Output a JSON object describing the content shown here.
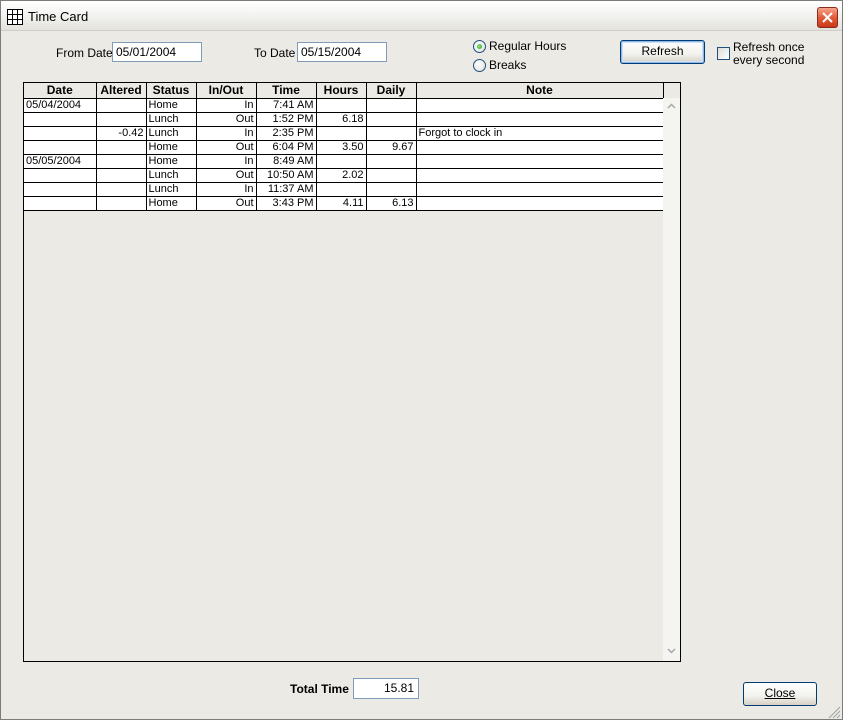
{
  "window": {
    "title": "Time Card",
    "icon": "grid-icon",
    "close_icon": "close-icon"
  },
  "filters": {
    "from_date_label": "From Date",
    "from_date_value": "05/01/2004",
    "to_date_label": "To Date",
    "to_date_value": "05/15/2004",
    "radio_regular": "Regular Hours",
    "radio_breaks": "Breaks",
    "selected_mode": "Regular Hours",
    "refresh_button": "Refresh",
    "refresh_checkbox_line1": "Refresh once",
    "refresh_checkbox_line2": "every second",
    "refresh_checkbox_checked": false
  },
  "grid": {
    "columns": [
      "Date",
      "Altered",
      "Status",
      "In/Out",
      "Time",
      "Hours",
      "Daily",
      "Note"
    ],
    "rows": [
      [
        "05/04/2004",
        "",
        "Home",
        "In",
        "7:41 AM",
        "",
        "",
        ""
      ],
      [
        "",
        "",
        "Lunch",
        "Out",
        "1:52 PM",
        "6.18",
        "",
        ""
      ],
      [
        "",
        "-0.42",
        "Lunch",
        "In",
        "2:35 PM",
        "",
        "",
        "Forgot to clock in"
      ],
      [
        "",
        "",
        "Home",
        "Out",
        "6:04 PM",
        "3.50",
        "9.67",
        ""
      ],
      [
        "05/05/2004",
        "",
        "Home",
        "In",
        "8:49 AM",
        "",
        "",
        ""
      ],
      [
        "",
        "",
        "Lunch",
        "Out",
        "10:50 AM",
        "2.02",
        "",
        ""
      ],
      [
        "",
        "",
        "Lunch",
        "In",
        "11:37 AM",
        "",
        "",
        ""
      ],
      [
        "",
        "",
        "Home",
        "Out",
        "3:43 PM",
        "4.11",
        "6.13",
        ""
      ]
    ]
  },
  "footer": {
    "total_label": "Total Time",
    "total_value": "15.81",
    "close_button": "Close"
  },
  "colors": {
    "window_bg": "#ebeae5",
    "input_border": "#7f9db9",
    "button_border": "#003c74",
    "close_red": "#e35c37"
  }
}
